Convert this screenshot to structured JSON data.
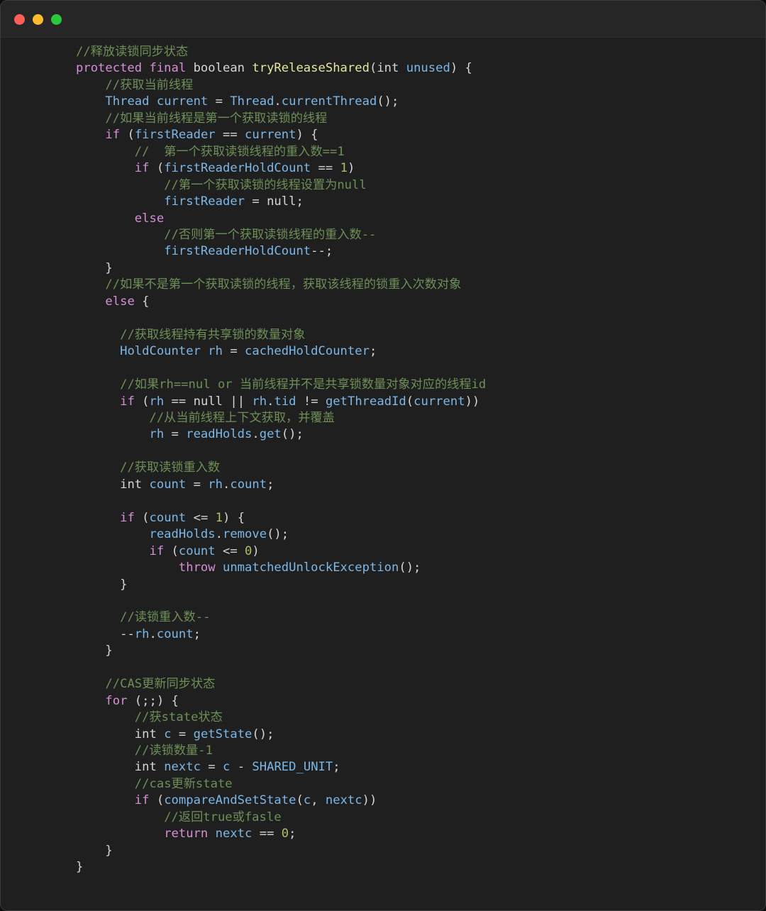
{
  "window": {
    "name": "code-snippet-window",
    "background": "#1e1f1e",
    "titlebar_background": "#252625",
    "border_color": "#3a3c3a",
    "traffic_lights": [
      {
        "name": "close-button",
        "color": "#fb5f57",
        "label": "Close"
      },
      {
        "name": "minimize-button",
        "color": "#fcbc2e",
        "label": "Minimize"
      },
      {
        "name": "maximize-button",
        "color": "#29c83f",
        "label": "Maximize"
      }
    ]
  },
  "theme": {
    "comment": "#6e8f58",
    "keyword": "#d78fd7",
    "identifier": "#7cb7e8",
    "function": "#e7e7a2",
    "plain": "#d6d6d6",
    "number": "#b5bd68"
  },
  "code": {
    "language": "java",
    "lines": [
      [
        {
          "t": "//释放读锁同步状态",
          "c": "cm"
        }
      ],
      [
        {
          "t": "protected final ",
          "c": "kw"
        },
        {
          "t": "boolean ",
          "c": "pl"
        },
        {
          "t": "tryReleaseShared",
          "c": "fn"
        },
        {
          "t": "(",
          "c": "pl"
        },
        {
          "t": "int ",
          "c": "pl"
        },
        {
          "t": "unused",
          "c": "id"
        },
        {
          "t": ") {",
          "c": "pl"
        }
      ],
      [
        {
          "t": "    ",
          "c": "pl"
        },
        {
          "t": "//获取当前线程",
          "c": "cm"
        }
      ],
      [
        {
          "t": "    ",
          "c": "pl"
        },
        {
          "t": "Thread current",
          "c": "id"
        },
        {
          "t": " = ",
          "c": "pl"
        },
        {
          "t": "Thread",
          "c": "id"
        },
        {
          "t": ".",
          "c": "pl"
        },
        {
          "t": "currentThread",
          "c": "id"
        },
        {
          "t": "();",
          "c": "pl"
        }
      ],
      [
        {
          "t": "    ",
          "c": "pl"
        },
        {
          "t": "//如果当前线程是第一个获取读锁的线程",
          "c": "cm"
        }
      ],
      [
        {
          "t": "    ",
          "c": "pl"
        },
        {
          "t": "if",
          "c": "kw"
        },
        {
          "t": " (",
          "c": "pl"
        },
        {
          "t": "firstReader",
          "c": "id"
        },
        {
          "t": " == ",
          "c": "pl"
        },
        {
          "t": "current",
          "c": "id"
        },
        {
          "t": ") {",
          "c": "pl"
        }
      ],
      [
        {
          "t": "        ",
          "c": "pl"
        },
        {
          "t": "//  第一个获取读锁线程的重入数==1",
          "c": "cm"
        }
      ],
      [
        {
          "t": "        ",
          "c": "pl"
        },
        {
          "t": "if",
          "c": "kw"
        },
        {
          "t": " (",
          "c": "pl"
        },
        {
          "t": "firstReaderHoldCount",
          "c": "id"
        },
        {
          "t": " == ",
          "c": "pl"
        },
        {
          "t": "1",
          "c": "nm"
        },
        {
          "t": ")",
          "c": "pl"
        }
      ],
      [
        {
          "t": "            ",
          "c": "pl"
        },
        {
          "t": "//第一个获取读锁的线程设置为null",
          "c": "cm"
        }
      ],
      [
        {
          "t": "            ",
          "c": "pl"
        },
        {
          "t": "firstReader",
          "c": "id"
        },
        {
          "t": " = ",
          "c": "pl"
        },
        {
          "t": "null",
          "c": "pl"
        },
        {
          "t": ";",
          "c": "pl"
        }
      ],
      [
        {
          "t": "        ",
          "c": "pl"
        },
        {
          "t": "else",
          "c": "kw"
        }
      ],
      [
        {
          "t": "            ",
          "c": "pl"
        },
        {
          "t": "//否则第一个获取读锁线程的重入数--",
          "c": "cm"
        }
      ],
      [
        {
          "t": "            ",
          "c": "pl"
        },
        {
          "t": "firstReaderHoldCount",
          "c": "id"
        },
        {
          "t": "--;",
          "c": "pl"
        }
      ],
      [
        {
          "t": "    }",
          "c": "pl"
        }
      ],
      [
        {
          "t": "    ",
          "c": "pl"
        },
        {
          "t": "//如果不是第一个获取读锁的线程，获取该线程的锁重入次数对象",
          "c": "cm"
        }
      ],
      [
        {
          "t": "    ",
          "c": "pl"
        },
        {
          "t": "else",
          "c": "kw"
        },
        {
          "t": " {",
          "c": "pl"
        }
      ],
      [
        {
          "t": "",
          "c": "pl"
        }
      ],
      [
        {
          "t": "      ",
          "c": "pl"
        },
        {
          "t": "//获取线程持有共享锁的数量对象",
          "c": "cm"
        }
      ],
      [
        {
          "t": "      ",
          "c": "pl"
        },
        {
          "t": "HoldCounter rh",
          "c": "id"
        },
        {
          "t": " = ",
          "c": "pl"
        },
        {
          "t": "cachedHoldCounter",
          "c": "id"
        },
        {
          "t": ";",
          "c": "pl"
        }
      ],
      [
        {
          "t": "",
          "c": "pl"
        }
      ],
      [
        {
          "t": "      ",
          "c": "pl"
        },
        {
          "t": "//如果rh==nul or 当前线程并不是共享锁数量对象对应的线程id",
          "c": "cm"
        }
      ],
      [
        {
          "t": "      ",
          "c": "pl"
        },
        {
          "t": "if",
          "c": "kw"
        },
        {
          "t": " (",
          "c": "pl"
        },
        {
          "t": "rh",
          "c": "id"
        },
        {
          "t": " == ",
          "c": "pl"
        },
        {
          "t": "null",
          "c": "pl"
        },
        {
          "t": " || ",
          "c": "pl"
        },
        {
          "t": "rh",
          "c": "id"
        },
        {
          "t": ".",
          "c": "pl"
        },
        {
          "t": "tid",
          "c": "id"
        },
        {
          "t": " != ",
          "c": "pl"
        },
        {
          "t": "getThreadId",
          "c": "id"
        },
        {
          "t": "(",
          "c": "pl"
        },
        {
          "t": "current",
          "c": "id"
        },
        {
          "t": "))",
          "c": "pl"
        }
      ],
      [
        {
          "t": "          ",
          "c": "pl"
        },
        {
          "t": "//从当前线程上下文获取，并覆盖",
          "c": "cm"
        }
      ],
      [
        {
          "t": "          ",
          "c": "pl"
        },
        {
          "t": "rh",
          "c": "id"
        },
        {
          "t": " = ",
          "c": "pl"
        },
        {
          "t": "readHolds",
          "c": "id"
        },
        {
          "t": ".",
          "c": "pl"
        },
        {
          "t": "get",
          "c": "id"
        },
        {
          "t": "();",
          "c": "pl"
        }
      ],
      [
        {
          "t": "",
          "c": "pl"
        }
      ],
      [
        {
          "t": "      ",
          "c": "pl"
        },
        {
          "t": "//获取读锁重入数",
          "c": "cm"
        }
      ],
      [
        {
          "t": "      ",
          "c": "pl"
        },
        {
          "t": "int ",
          "c": "pl"
        },
        {
          "t": "count",
          "c": "id"
        },
        {
          "t": " = ",
          "c": "pl"
        },
        {
          "t": "rh",
          "c": "id"
        },
        {
          "t": ".",
          "c": "pl"
        },
        {
          "t": "count",
          "c": "id"
        },
        {
          "t": ";",
          "c": "pl"
        }
      ],
      [
        {
          "t": "",
          "c": "pl"
        }
      ],
      [
        {
          "t": "      ",
          "c": "pl"
        },
        {
          "t": "if",
          "c": "kw"
        },
        {
          "t": " (",
          "c": "pl"
        },
        {
          "t": "count",
          "c": "id"
        },
        {
          "t": " <= ",
          "c": "pl"
        },
        {
          "t": "1",
          "c": "nm"
        },
        {
          "t": ") {",
          "c": "pl"
        }
      ],
      [
        {
          "t": "          ",
          "c": "pl"
        },
        {
          "t": "readHolds",
          "c": "id"
        },
        {
          "t": ".",
          "c": "pl"
        },
        {
          "t": "remove",
          "c": "id"
        },
        {
          "t": "();",
          "c": "pl"
        }
      ],
      [
        {
          "t": "          ",
          "c": "pl"
        },
        {
          "t": "if",
          "c": "kw"
        },
        {
          "t": " (",
          "c": "pl"
        },
        {
          "t": "count",
          "c": "id"
        },
        {
          "t": " <= ",
          "c": "pl"
        },
        {
          "t": "0",
          "c": "nm"
        },
        {
          "t": ")",
          "c": "pl"
        }
      ],
      [
        {
          "t": "              ",
          "c": "pl"
        },
        {
          "t": "throw",
          "c": "kw"
        },
        {
          "t": " ",
          "c": "pl"
        },
        {
          "t": "unmatchedUnlockException",
          "c": "id"
        },
        {
          "t": "();",
          "c": "pl"
        }
      ],
      [
        {
          "t": "      }",
          "c": "pl"
        }
      ],
      [
        {
          "t": "",
          "c": "pl"
        }
      ],
      [
        {
          "t": "      ",
          "c": "pl"
        },
        {
          "t": "//读锁重入数--",
          "c": "cm"
        }
      ],
      [
        {
          "t": "      ",
          "c": "pl"
        },
        {
          "t": "--",
          "c": "pl"
        },
        {
          "t": "rh",
          "c": "id"
        },
        {
          "t": ".",
          "c": "pl"
        },
        {
          "t": "count",
          "c": "id"
        },
        {
          "t": ";",
          "c": "pl"
        }
      ],
      [
        {
          "t": "    }",
          "c": "pl"
        }
      ],
      [
        {
          "t": "",
          "c": "pl"
        }
      ],
      [
        {
          "t": "    ",
          "c": "pl"
        },
        {
          "t": "//CAS更新同步状态",
          "c": "cm"
        }
      ],
      [
        {
          "t": "    ",
          "c": "pl"
        },
        {
          "t": "for",
          "c": "kw"
        },
        {
          "t": " (;;) {",
          "c": "pl"
        }
      ],
      [
        {
          "t": "        ",
          "c": "pl"
        },
        {
          "t": "//获state状态",
          "c": "cm"
        }
      ],
      [
        {
          "t": "        ",
          "c": "pl"
        },
        {
          "t": "int ",
          "c": "pl"
        },
        {
          "t": "c",
          "c": "id"
        },
        {
          "t": " = ",
          "c": "pl"
        },
        {
          "t": "getState",
          "c": "id"
        },
        {
          "t": "();",
          "c": "pl"
        }
      ],
      [
        {
          "t": "        ",
          "c": "pl"
        },
        {
          "t": "//读锁数量-1",
          "c": "cm"
        }
      ],
      [
        {
          "t": "        ",
          "c": "pl"
        },
        {
          "t": "int ",
          "c": "pl"
        },
        {
          "t": "nextc",
          "c": "id"
        },
        {
          "t": " = ",
          "c": "pl"
        },
        {
          "t": "c",
          "c": "id"
        },
        {
          "t": " - ",
          "c": "pl"
        },
        {
          "t": "SHARED_UNIT",
          "c": "id"
        },
        {
          "t": ";",
          "c": "pl"
        }
      ],
      [
        {
          "t": "        ",
          "c": "pl"
        },
        {
          "t": "//cas更新state",
          "c": "cm"
        }
      ],
      [
        {
          "t": "        ",
          "c": "pl"
        },
        {
          "t": "if",
          "c": "kw"
        },
        {
          "t": " (",
          "c": "pl"
        },
        {
          "t": "compareAndSetState",
          "c": "id"
        },
        {
          "t": "(",
          "c": "pl"
        },
        {
          "t": "c",
          "c": "id"
        },
        {
          "t": ", ",
          "c": "pl"
        },
        {
          "t": "nextc",
          "c": "id"
        },
        {
          "t": "))",
          "c": "pl"
        }
      ],
      [
        {
          "t": "            ",
          "c": "pl"
        },
        {
          "t": "//返回true或fasle",
          "c": "cm"
        }
      ],
      [
        {
          "t": "            ",
          "c": "pl"
        },
        {
          "t": "return",
          "c": "kw"
        },
        {
          "t": " ",
          "c": "pl"
        },
        {
          "t": "nextc",
          "c": "id"
        },
        {
          "t": " == ",
          "c": "pl"
        },
        {
          "t": "0",
          "c": "nm"
        },
        {
          "t": ";",
          "c": "pl"
        }
      ],
      [
        {
          "t": "    }",
          "c": "pl"
        }
      ],
      [
        {
          "t": "}",
          "c": "pl"
        }
      ]
    ]
  }
}
